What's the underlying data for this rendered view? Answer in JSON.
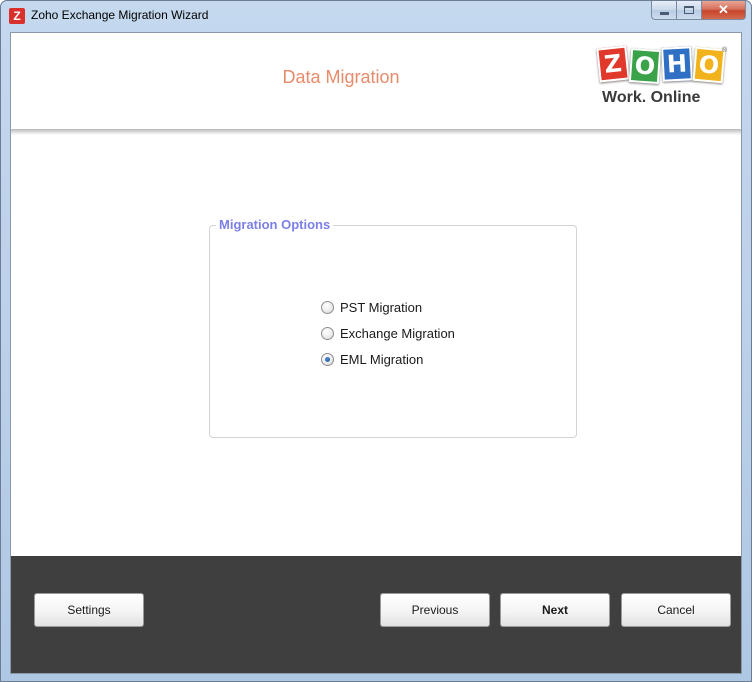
{
  "window": {
    "title": "Zoho Exchange Migration Wizard",
    "icon_letter": "Z"
  },
  "header": {
    "title": "Data Migration",
    "logo": {
      "letters": [
        "Z",
        "O",
        "H",
        "O"
      ],
      "letter_colors": [
        "#e0392b",
        "#3aa34a",
        "#2f6fc4",
        "#f2b21b"
      ],
      "tagline": "Work. Online",
      "trademark": "®"
    }
  },
  "migration_options": {
    "legend": "Migration Options",
    "options": [
      {
        "label": "PST Migration",
        "selected": false
      },
      {
        "label": "Exchange Migration",
        "selected": false
      },
      {
        "label": "EML Migration",
        "selected": true
      }
    ]
  },
  "footer": {
    "settings_label": "Settings",
    "previous_label": "Previous",
    "next_label": "Next",
    "cancel_label": "Cancel"
  },
  "colors": {
    "header_title": "#e88b6a",
    "legend": "#7c80e8",
    "footer_bg": "#3f3f3f"
  }
}
